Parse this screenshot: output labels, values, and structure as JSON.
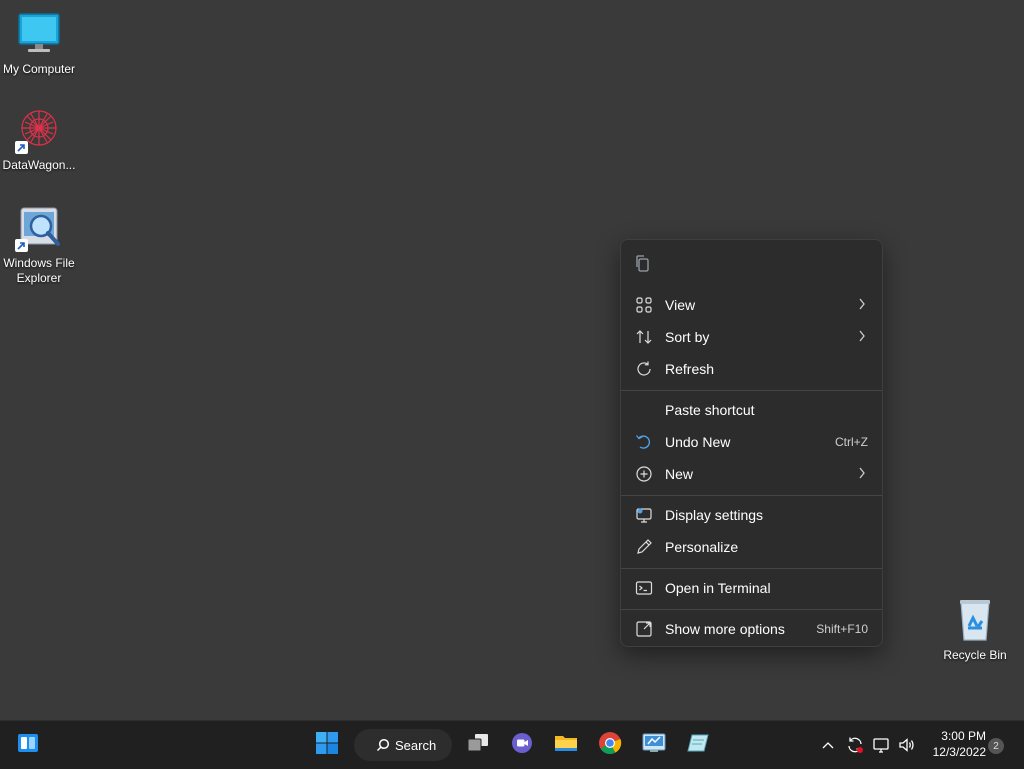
{
  "desktop": {
    "icons": [
      {
        "label": "My Computer",
        "icon": "monitor-icon"
      },
      {
        "label": "DataWagon...",
        "icon": "datawagon-app-icon"
      },
      {
        "label": "Windows File Explorer",
        "icon": "file-explorer-magnifier-icon"
      },
      {
        "label": "Recycle Bin",
        "icon": "recycle-bin-icon"
      }
    ]
  },
  "context_menu": {
    "top_icons": [
      "copy-icon"
    ],
    "items": [
      {
        "label": "View",
        "icon": "grid-view-icon",
        "submenu": true
      },
      {
        "label": "Sort by",
        "icon": "sort-icon",
        "submenu": true
      },
      {
        "label": "Refresh",
        "icon": "refresh-icon"
      },
      {
        "label": "Paste shortcut",
        "icon": ""
      },
      {
        "label": "Undo New",
        "icon": "undo-icon",
        "shortcut": "Ctrl+Z"
      },
      {
        "label": "New",
        "icon": "new-plus-icon",
        "submenu": true
      },
      {
        "label": "Display settings",
        "icon": "display-settings-icon"
      },
      {
        "label": "Personalize",
        "icon": "pen-icon"
      },
      {
        "label": "Open in Terminal",
        "icon": "terminal-icon"
      },
      {
        "label": "Show more options",
        "icon": "more-options-icon",
        "shortcut": "Shift+F10"
      }
    ]
  },
  "taskbar": {
    "search_label": "Search",
    "clock_time": "3:00 PM",
    "clock_date": "12/3/2022",
    "notification_count": "2",
    "accent": "#0078d4"
  }
}
